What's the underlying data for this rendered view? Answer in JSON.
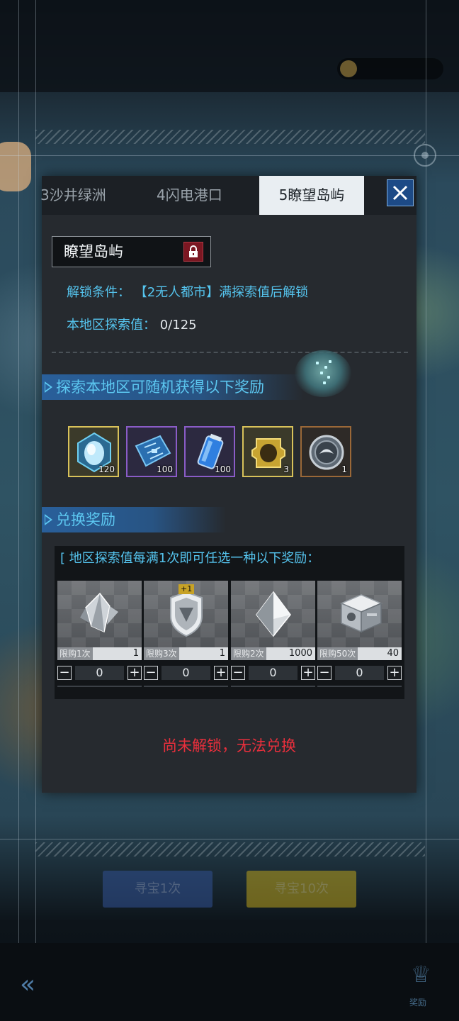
{
  "tabs": [
    {
      "label": "3沙井绿洲",
      "active": false
    },
    {
      "label": "4闪电港口",
      "active": false
    },
    {
      "label": "5瞭望岛屿",
      "active": true
    }
  ],
  "region": {
    "name": "瞭望岛屿",
    "locked": true
  },
  "unlock_condition": {
    "label": "解锁条件：",
    "text": "【2无人都市】满探索值后解锁"
  },
  "exploration": {
    "label": "本地区探索值：",
    "value": "0/125"
  },
  "random_rewards": {
    "title": "探索本地区可随机获得以下奖励",
    "items": [
      {
        "icon": "blue-crystal-egg-icon",
        "quantity": "120",
        "rarity_color": "#d8c25a"
      },
      {
        "icon": "circuit-board-icon",
        "quantity": "100",
        "rarity_color": "#8a5cc7"
      },
      {
        "icon": "energy-battery-icon",
        "quantity": "100",
        "rarity_color": "#8a5cc7"
      },
      {
        "icon": "golden-gear-frame-icon",
        "quantity": "3",
        "rarity_color": "#d8c25a"
      },
      {
        "icon": "silver-emblem-coin-icon",
        "quantity": "1",
        "rarity_color": "#9a6838"
      }
    ]
  },
  "exchange": {
    "title": "兑换奖励",
    "subtitle": "[ 地区探索值每满1次即可任选一种以下奖励：",
    "items": [
      {
        "icon": "crystal-cluster-icon",
        "badge": "",
        "limit": "限购1次",
        "price": "1",
        "quantity": "0"
      },
      {
        "icon": "shield-chip-icon",
        "badge": "+1",
        "limit": "限购3次",
        "price": "1",
        "quantity": "0"
      },
      {
        "icon": "silver-octahedron-icon",
        "badge": "",
        "limit": "限购2次",
        "price": "1000",
        "quantity": "0"
      },
      {
        "icon": "supply-crate-icon",
        "badge": "",
        "limit": "限购50次",
        "price": "40",
        "quantity": "0"
      }
    ]
  },
  "locked_message": "尚未解锁，无法兑换",
  "background": {
    "button_left": "寻宝1次",
    "button_right": "寻宝10次",
    "trophy_label": "奖励"
  },
  "colors": {
    "accent_cyan": "#55c4ee",
    "error_red": "#ea2f3c",
    "close_blue": "#1d4a86"
  }
}
